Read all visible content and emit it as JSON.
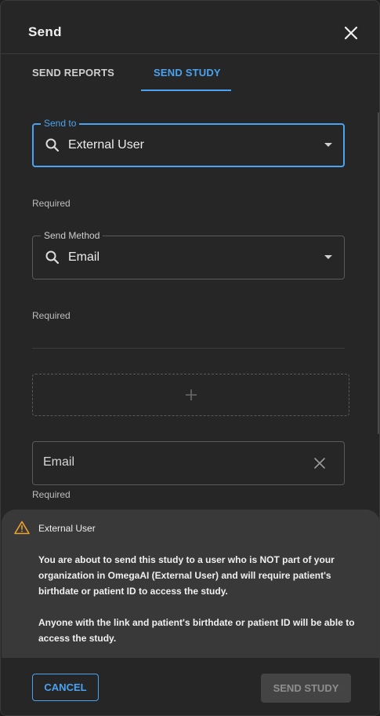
{
  "dialog": {
    "title": "Send"
  },
  "tabs": [
    {
      "label": "SEND REPORTS",
      "active": false
    },
    {
      "label": "SEND STUDY",
      "active": true
    }
  ],
  "send_to": {
    "legend": "Send to",
    "value": "External User",
    "helper": "Required"
  },
  "send_method": {
    "legend": "Send Method",
    "value": "Email",
    "helper": "Required"
  },
  "email": {
    "placeholder": "Email",
    "helper": "Required"
  },
  "warning": {
    "title": "External User",
    "paragraph1": "You are about to send this study to a user who is NOT part of your organization in OmegaAI (External User) and will require patient's birthdate or patient ID to access the study.",
    "paragraph2": "Anyone with the link and patient's birthdate or patient ID will be able to access the study."
  },
  "footer": {
    "cancel_label": "CANCEL",
    "send_label": "SEND STUDY"
  },
  "icons": {
    "close": "close-icon",
    "search": "search-icon",
    "dropdown": "chevron-down-icon",
    "add": "plus-icon",
    "clear": "clear-icon",
    "warning": "warning-icon"
  },
  "colors": {
    "accent": "#4aa3f0",
    "warning": "#f0a22e",
    "background": "#262626",
    "banner": "#393939",
    "disabled_button": "#444444"
  }
}
